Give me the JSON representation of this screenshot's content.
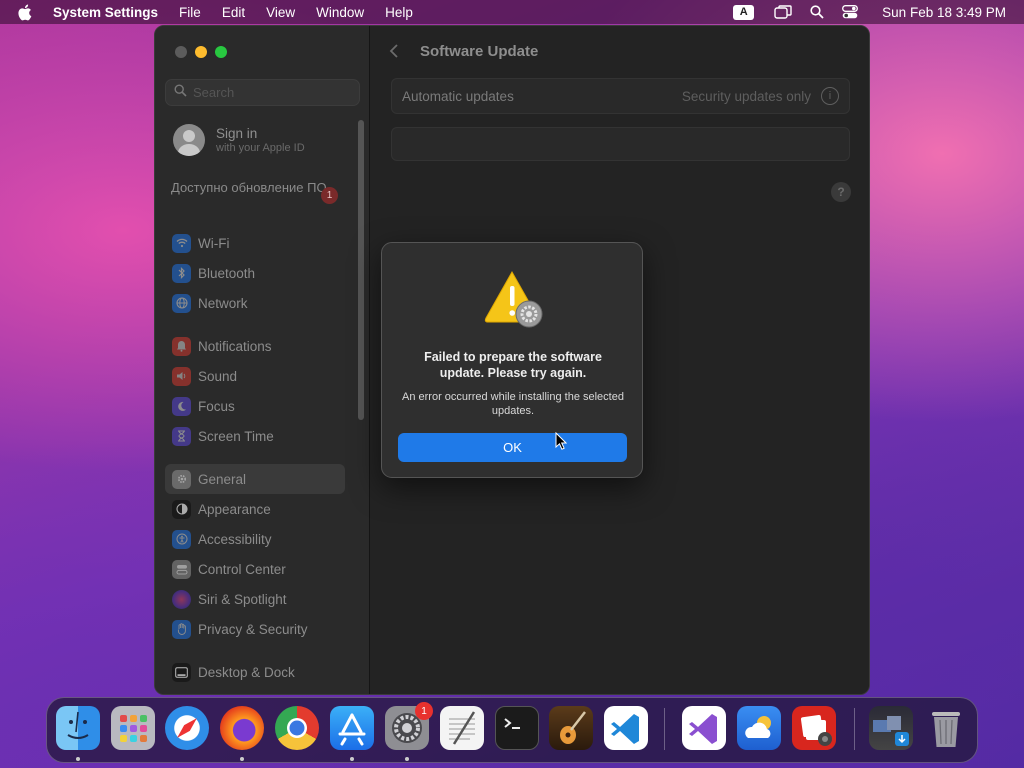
{
  "menubar": {
    "app_name": "System Settings",
    "menus": [
      "File",
      "Edit",
      "View",
      "Window",
      "Help"
    ],
    "input_source": "A",
    "clock": "Sun Feb 18  3:49 PM"
  },
  "sidebar": {
    "search_placeholder": "Search",
    "sign_in": {
      "title": "Sign in",
      "subtitle": "with your Apple ID"
    },
    "update_notice": "Доступно обновление ПО",
    "update_count": "1",
    "items": [
      {
        "label": "Wi-Fi",
        "icon": "wifi-icon",
        "color": "#1e6fe0"
      },
      {
        "label": "Bluetooth",
        "icon": "bluetooth-icon",
        "color": "#1e6fe0"
      },
      {
        "label": "Network",
        "icon": "globe-icon",
        "color": "#1e6fe0"
      },
      {
        "label": "Notifications",
        "icon": "bell-icon",
        "color": "#e0382e"
      },
      {
        "label": "Sound",
        "icon": "speaker-icon",
        "color": "#e0382e"
      },
      {
        "label": "Focus",
        "icon": "moon-icon",
        "color": "#5a46d6"
      },
      {
        "label": "Screen Time",
        "icon": "hourglass-icon",
        "color": "#5a46d6"
      },
      {
        "label": "General",
        "icon": "gear-icon",
        "color": "#8a8a8a"
      },
      {
        "label": "Appearance",
        "icon": "appearance-icon",
        "color": "#1a1a1a"
      },
      {
        "label": "Accessibility",
        "icon": "accessibility-icon",
        "color": "#1e6fe0"
      },
      {
        "label": "Control Center",
        "icon": "control-center-icon",
        "color": "#8a8a8a"
      },
      {
        "label": "Siri & Spotlight",
        "icon": "siri-icon",
        "color": "#a040c0"
      },
      {
        "label": "Privacy & Security",
        "icon": "hand-icon",
        "color": "#1e6fe0"
      },
      {
        "label": "Desktop & Dock",
        "icon": "dock-icon",
        "color": "#1a1a1a"
      }
    ],
    "selected": "General"
  },
  "content": {
    "title": "Software Update",
    "auto_updates_label": "Automatic updates",
    "auto_updates_value": "Security updates only",
    "help": "?"
  },
  "dialog": {
    "title": "Failed to prepare the software update. Please try again.",
    "message": "An error occurred while installing the selected updates.",
    "ok_label": "OK"
  },
  "dock": {
    "settings_badge": "1",
    "apps": [
      "Finder",
      "Launchpad",
      "Safari",
      "Firefox",
      "Chrome",
      "App Store",
      "System Settings",
      "TextEdit",
      "Terminal",
      "GarageBand",
      "Visual Studio Code",
      "Visual Studio",
      "Weather",
      "Photo Booth",
      "Downloads",
      "Trash"
    ]
  }
}
